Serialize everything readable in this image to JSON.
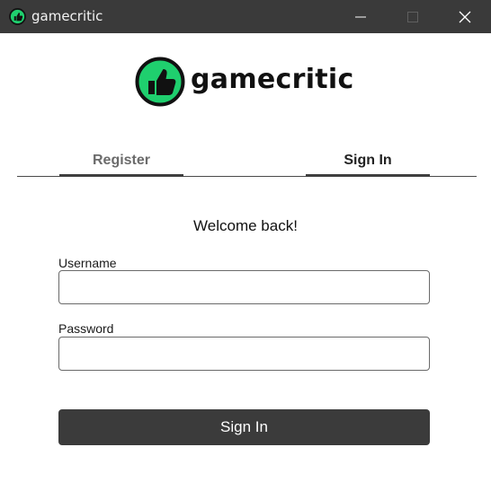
{
  "window": {
    "title": "gamecritic",
    "icons": {
      "app": "thumbs-up-logo-icon",
      "minimize": "minimize-icon",
      "maximize": "maximize-icon",
      "close": "close-icon"
    }
  },
  "brand": {
    "name": "gamecritic",
    "accent_color": "#1fcf6e",
    "dark_color": "#111111"
  },
  "tabs": [
    {
      "label": "Register",
      "active": false
    },
    {
      "label": "Sign In",
      "active": true
    }
  ],
  "form": {
    "heading": "Welcome back!",
    "username_label": "Username",
    "username_value": "",
    "password_label": "Password",
    "password_value": "",
    "submit_label": "Sign In"
  },
  "colors": {
    "titlebar_bg": "#3a3a3a",
    "button_bg": "#3b3b3b",
    "field_border": "#6a6a6a"
  }
}
